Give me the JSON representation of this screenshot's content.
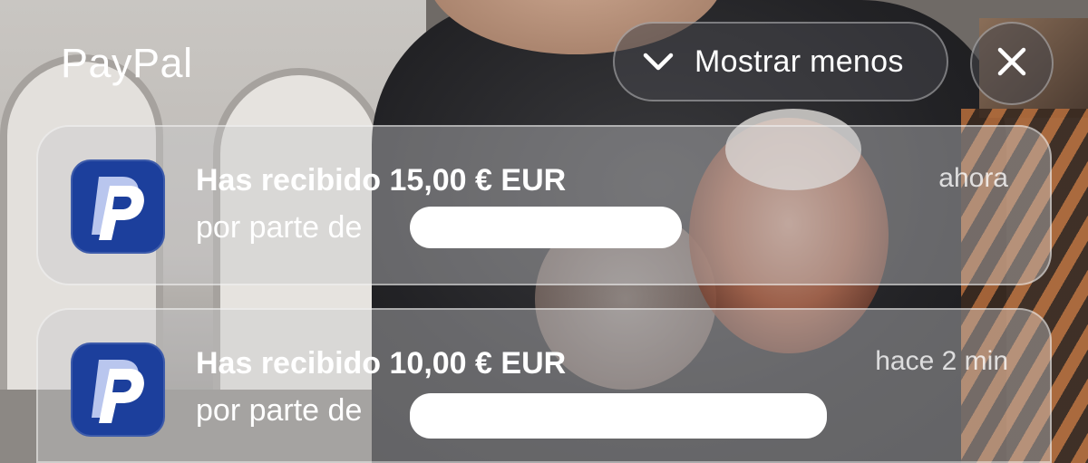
{
  "app": {
    "title": "PayPal"
  },
  "header": {
    "show_less_label": "Mostrar menos",
    "show_less_icon": "chevron-down-icon",
    "close_icon": "close-icon"
  },
  "notifications": [
    {
      "title": "Has recibido 15,00 € EUR",
      "body": "por parte de",
      "time": "ahora",
      "icon": "paypal-logo-icon"
    },
    {
      "title": "Has recibido 10,00 € EUR",
      "body": "por parte de",
      "time": "hace 2 min",
      "icon": "paypal-logo-icon"
    }
  ],
  "colors": {
    "paypal_blue": "#1c3f9c",
    "paypal_light": "#b9c6ee"
  }
}
